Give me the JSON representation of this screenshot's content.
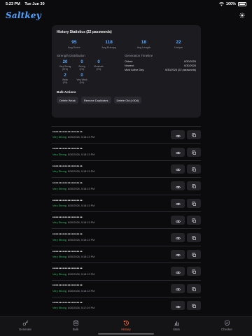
{
  "status_bar": {
    "time": "5:23 PM",
    "date": "Tue Jun 30",
    "battery": "100%"
  },
  "header": {
    "app_name": "Saltkey"
  },
  "stats": {
    "title": "History Statistics (22 passwords)",
    "top": [
      {
        "value": "95",
        "label": "Avg Score"
      },
      {
        "value": "118",
        "label": "Avg Entropy"
      },
      {
        "value": "18",
        "label": "Avg Length"
      },
      {
        "value": "22",
        "label": "Unique"
      }
    ],
    "distribution_label": "Strength Distribution",
    "distribution": [
      {
        "value": "20",
        "label": "Very Strong",
        "pct": "(91%)"
      },
      {
        "value": "0",
        "label": "Strong",
        "pct": "(0%)"
      },
      {
        "value": "0",
        "label": "Moderate",
        "pct": "(0%)"
      },
      {
        "value": "2",
        "label": "Weak",
        "pct": "(9%)"
      },
      {
        "value": "0",
        "label": "Very Weak",
        "pct": "(0%)"
      }
    ],
    "timeline_label": "Generation Timeline",
    "timeline": [
      {
        "label": "Oldest:",
        "value": "6/30/2026"
      },
      {
        "label": "Newest:",
        "value": "6/30/2026"
      },
      {
        "label": "Most Active Day:",
        "value": "6/30/2026 (22 passwords)"
      }
    ],
    "bulk_title": "Bulk Actions",
    "bulk_actions": [
      "Delete Weak",
      "Remove Duplicates",
      "Delete Old (>30d)"
    ]
  },
  "history": [
    {
      "masked": "••••••••••••••••••••",
      "strength": "Very Strong",
      "timestamp": "6/30/2026, 5:18:13 PM"
    },
    {
      "masked": "••••••••••••••••••••",
      "strength": "Very Strong",
      "timestamp": "6/30/2026, 5:18:13 PM"
    },
    {
      "masked": "••••••••••••••••••••",
      "strength": "Very Strong",
      "timestamp": "6/30/2026, 5:18:13 PM"
    },
    {
      "masked": "••••••••••••••••••••",
      "strength": "Very Strong",
      "timestamp": "6/30/2026, 5:18:13 PM"
    },
    {
      "masked": "••••••••••••••••••••",
      "strength": "Very Strong",
      "timestamp": "6/30/2026, 5:18:13 PM"
    },
    {
      "masked": "••••••••••••••••••••",
      "strength": "Very Strong",
      "timestamp": "6/30/2026, 5:18:13 PM"
    },
    {
      "masked": "••••••••••••••••••••",
      "strength": "Very Strong",
      "timestamp": "6/30/2026, 5:18:13 PM"
    },
    {
      "masked": "••••••••••••••••••••",
      "strength": "Very Strong",
      "timestamp": "6/30/2026, 5:18:13 PM"
    },
    {
      "masked": "••••••••••••••••••••",
      "strength": "Very Strong",
      "timestamp": "6/30/2026, 5:18:13 PM"
    },
    {
      "masked": "••••••••••••••••••••",
      "strength": "Very Strong",
      "timestamp": "6/30/2026, 5:18:13 PM"
    },
    {
      "masked": "••••••••••••••••••••",
      "strength": "Very Strong",
      "timestamp": "6/30/2026, 5:17:29 PM"
    }
  ],
  "tabs": [
    {
      "label": "Generate",
      "icon": "key-icon",
      "active": false
    },
    {
      "label": "Bulk",
      "icon": "database-icon",
      "active": false
    },
    {
      "label": "History",
      "icon": "history-icon",
      "active": true
    },
    {
      "label": "Stats",
      "icon": "chart-icon",
      "active": false
    },
    {
      "label": "Checker",
      "icon": "shield-check-icon",
      "active": false
    }
  ],
  "colors": {
    "accent": "#5aa8ff",
    "active_tab": "#ff6a3c",
    "strength_good": "#33c26a",
    "background": "#0b0b0d",
    "card": "#1c1c20"
  }
}
